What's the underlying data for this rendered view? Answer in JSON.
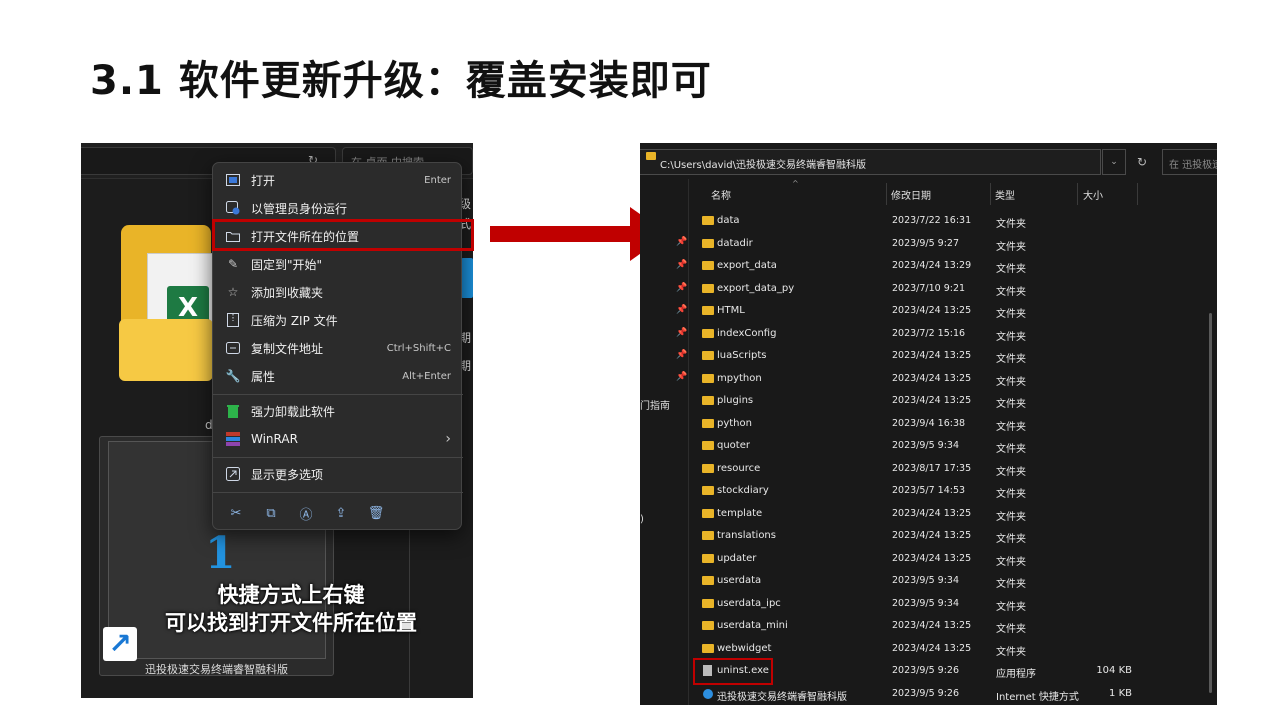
{
  "title": "3.1 软件更新升级：覆盖安装即可",
  "left": {
    "search_placeholder": "在 桌面 中搜索",
    "desktop_label_fragment": "d",
    "right_strip": [
      "级",
      "式",
      "期",
      "期"
    ],
    "context_menu": {
      "items": [
        {
          "icon": "open-icon",
          "label": "打开",
          "shortcut": "Enter"
        },
        {
          "icon": "shield-icon",
          "label": "以管理员身份运行",
          "shortcut": ""
        },
        {
          "icon": "folder-icon",
          "label": "打开文件所在的位置",
          "shortcut": ""
        },
        {
          "icon": "pin-icon",
          "label": "固定到\"开始\"",
          "shortcut": ""
        },
        {
          "icon": "star-icon",
          "label": "添加到收藏夹",
          "shortcut": ""
        },
        {
          "icon": "zip-icon",
          "label": "压缩为 ZIP 文件",
          "shortcut": ""
        },
        {
          "icon": "copy-path-icon",
          "label": "复制文件地址",
          "shortcut": "Ctrl+Shift+C"
        },
        {
          "icon": "wrench-icon",
          "label": "属性",
          "shortcut": "Alt+Enter"
        },
        {
          "icon": "uninstall-icon",
          "label": "强力卸载此软件",
          "shortcut": ""
        },
        {
          "icon": "winrar-icon",
          "label": "WinRAR",
          "shortcut": "›"
        },
        {
          "icon": "more-options-icon",
          "label": "显示更多选项",
          "shortcut": ""
        }
      ],
      "actions": [
        {
          "name": "cut-icon",
          "glyph": "✂"
        },
        {
          "name": "copy-icon",
          "glyph": "⧉"
        },
        {
          "name": "rename-icon",
          "glyph": "Ⓐ"
        },
        {
          "name": "share-icon",
          "glyph": "⇪"
        },
        {
          "name": "delete-icon",
          "glyph": "🗑"
        }
      ]
    },
    "shortcut_name": "迅投极速交易终端睿智融科版",
    "caption_line1": "快捷方式上右键",
    "caption_line2": "可以找到打开文件所在位置",
    "highlight_color": "#c00000"
  },
  "right": {
    "address": "C:\\Users\\david\\迅投极速交易终端睿智融科版",
    "search_placeholder": "在 迅投极速",
    "columns": {
      "name": "名称",
      "date": "修改日期",
      "type": "类型",
      "size": "大小"
    },
    "nav_fragments": [
      "门指南",
      ")"
    ],
    "files": [
      {
        "name": "data",
        "date": "2023/7/22 16:31",
        "type": "文件夹",
        "size": "",
        "kind": "folder"
      },
      {
        "name": "datadir",
        "date": "2023/9/5 9:27",
        "type": "文件夹",
        "size": "",
        "kind": "folder"
      },
      {
        "name": "export_data",
        "date": "2023/4/24 13:29",
        "type": "文件夹",
        "size": "",
        "kind": "folder"
      },
      {
        "name": "export_data_py",
        "date": "2023/7/10 9:21",
        "type": "文件夹",
        "size": "",
        "kind": "folder"
      },
      {
        "name": "HTML",
        "date": "2023/4/24 13:25",
        "type": "文件夹",
        "size": "",
        "kind": "folder"
      },
      {
        "name": "indexConfig",
        "date": "2023/7/2 15:16",
        "type": "文件夹",
        "size": "",
        "kind": "folder"
      },
      {
        "name": "luaScripts",
        "date": "2023/4/24 13:25",
        "type": "文件夹",
        "size": "",
        "kind": "folder"
      },
      {
        "name": "mpython",
        "date": "2023/4/24 13:25",
        "type": "文件夹",
        "size": "",
        "kind": "folder"
      },
      {
        "name": "plugins",
        "date": "2023/4/24 13:25",
        "type": "文件夹",
        "size": "",
        "kind": "folder"
      },
      {
        "name": "python",
        "date": "2023/9/4 16:38",
        "type": "文件夹",
        "size": "",
        "kind": "folder"
      },
      {
        "name": "quoter",
        "date": "2023/9/5 9:34",
        "type": "文件夹",
        "size": "",
        "kind": "folder"
      },
      {
        "name": "resource",
        "date": "2023/8/17 17:35",
        "type": "文件夹",
        "size": "",
        "kind": "folder"
      },
      {
        "name": "stockdiary",
        "date": "2023/5/7 14:53",
        "type": "文件夹",
        "size": "",
        "kind": "folder"
      },
      {
        "name": "template",
        "date": "2023/4/24 13:25",
        "type": "文件夹",
        "size": "",
        "kind": "folder"
      },
      {
        "name": "translations",
        "date": "2023/4/24 13:25",
        "type": "文件夹",
        "size": "",
        "kind": "folder"
      },
      {
        "name": "updater",
        "date": "2023/4/24 13:25",
        "type": "文件夹",
        "size": "",
        "kind": "folder"
      },
      {
        "name": "userdata",
        "date": "2023/9/5 9:34",
        "type": "文件夹",
        "size": "",
        "kind": "folder"
      },
      {
        "name": "userdata_ipc",
        "date": "2023/9/5 9:34",
        "type": "文件夹",
        "size": "",
        "kind": "folder"
      },
      {
        "name": "userdata_mini",
        "date": "2023/4/24 13:25",
        "type": "文件夹",
        "size": "",
        "kind": "folder"
      },
      {
        "name": "webwidget",
        "date": "2023/4/24 13:25",
        "type": "文件夹",
        "size": "",
        "kind": "folder"
      },
      {
        "name": "uninst.exe",
        "date": "2023/9/5 9:26",
        "type": "应用程序",
        "size": "104 KB",
        "kind": "exe"
      },
      {
        "name": "迅投极速交易终端睿智融科版",
        "date": "2023/9/5 9:26",
        "type": "Internet 快捷方式",
        "size": "1 KB",
        "kind": "lnk"
      }
    ]
  },
  "colors": {
    "highlight": "#c00000",
    "folder": "#e9b428",
    "arrow": "#c00000"
  }
}
